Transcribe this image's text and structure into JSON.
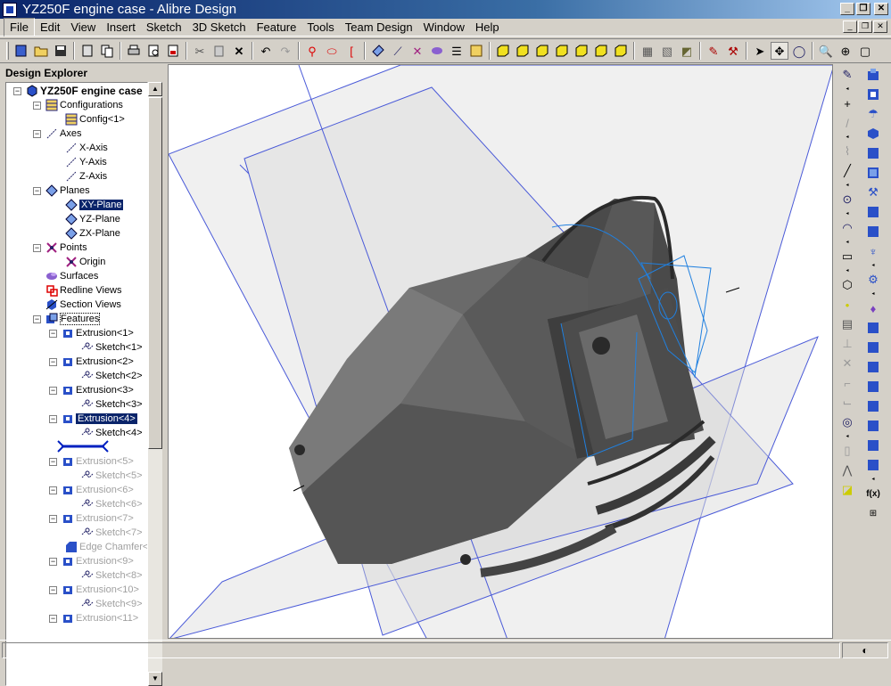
{
  "window": {
    "title": "YZ250F engine case - Alibre Design"
  },
  "menu": [
    "File",
    "Edit",
    "View",
    "Insert",
    "Sketch",
    "3D Sketch",
    "Feature",
    "Tools",
    "Team Design",
    "Window",
    "Help"
  ],
  "explorer": {
    "title": "Design Explorer",
    "root": "YZ250F engine case",
    "items": {
      "configurations": "Configurations",
      "config1": "Config<1>",
      "axes": "Axes",
      "xaxis": "X-Axis",
      "yaxis": "Y-Axis",
      "zaxis": "Z-Axis",
      "planes": "Planes",
      "xyplane": "XY-Plane",
      "yzplane": "YZ-Plane",
      "zxplane": "ZX-Plane",
      "points": "Points",
      "origin": "Origin",
      "surfaces": "Surfaces",
      "redline": "Redline Views",
      "section": "Section Views",
      "features": "Features",
      "ext1": "Extrusion<1>",
      "sk1": "Sketch<1>",
      "ext2": "Extrusion<2>",
      "sk2": "Sketch<2>",
      "ext3": "Extrusion<3>",
      "sk3": "Sketch<3>",
      "ext4": "Extrusion<4>",
      "sk4": "Sketch<4>",
      "ext5": "Extrusion<5>",
      "sk5": "Sketch<5>",
      "ext6": "Extrusion<6>",
      "sk6": "Sketch<6>",
      "ext7": "Extrusion<7>",
      "sk7": "Sketch<7>",
      "chamfer": "Edge Chamfer<",
      "ext9": "Extrusion<9>",
      "sk8": "Sketch<8>",
      "ext10": "Extrusion<10>",
      "sk9": "Sketch<9>",
      "ext11": "Extrusion<11>"
    }
  }
}
